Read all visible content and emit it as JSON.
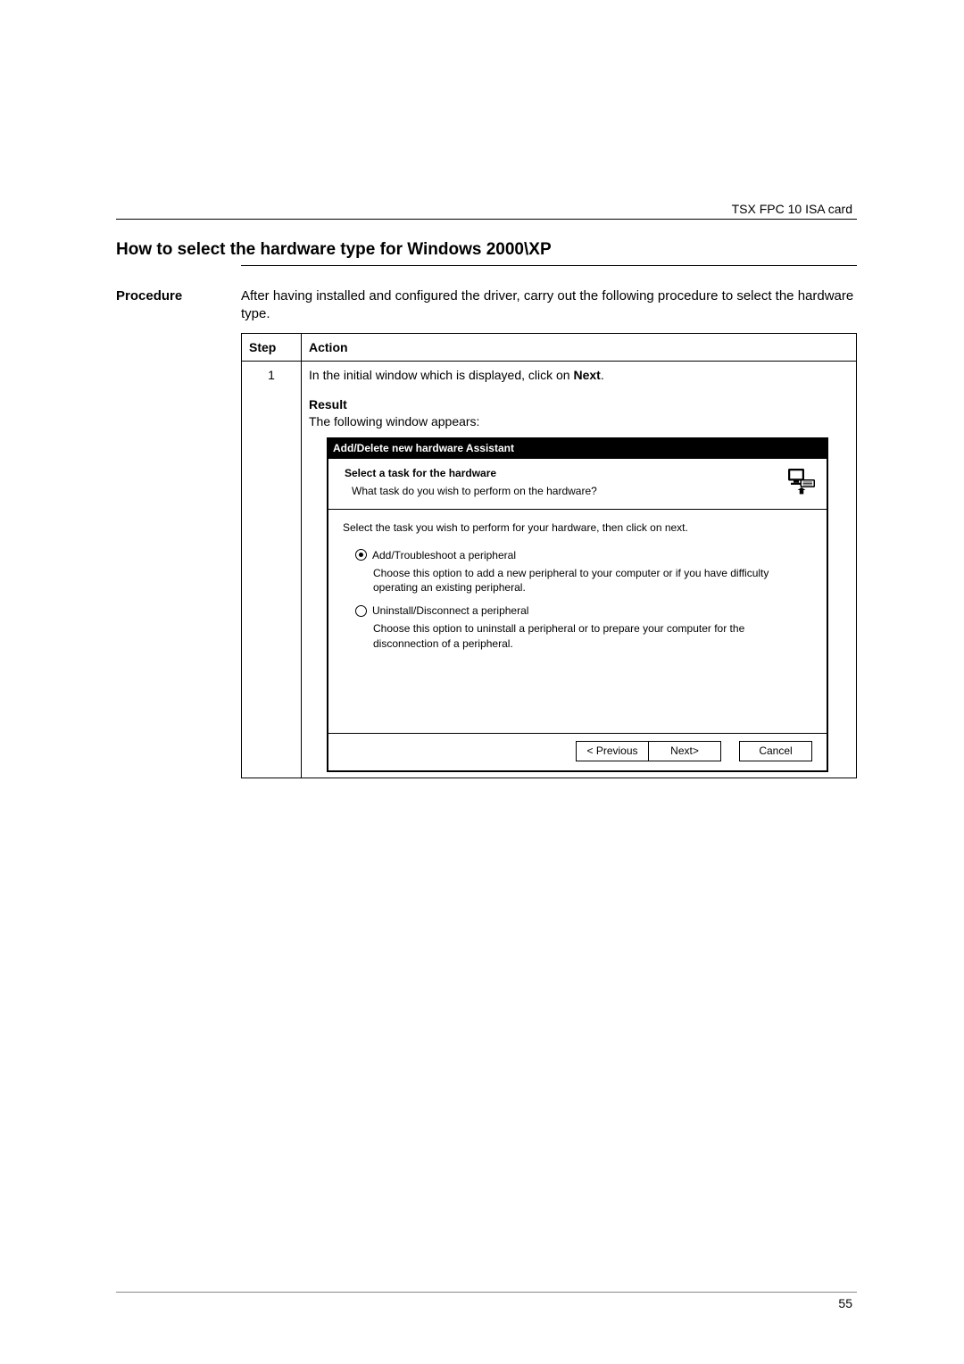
{
  "header": {
    "doc_label": "TSX FPC 10 ISA card"
  },
  "section_title": "How to select the hardware type for Windows 2000\\XP",
  "procedure": {
    "side_label": "Procedure",
    "intro": "After having installed and configured the driver, carry out the following procedure to select the hardware type.",
    "table": {
      "headers": {
        "step": "Step",
        "action": "Action"
      },
      "row1": {
        "step": "1",
        "action_pre": "In the initial window which is displayed, click on ",
        "action_bold": "Next",
        "action_post": ".",
        "result_label": "Result",
        "result_desc": "The following window appears:"
      }
    }
  },
  "wizard": {
    "titlebar": "Add/Delete new hardware Assistant",
    "header_title": "Select a task for the hardware",
    "header_sub": "What task do you wish to perform on the hardware?",
    "instruction": "Select the task you wish to perform for your hardware, then click on next.",
    "options": [
      {
        "label": "Add/Troubleshoot a peripheral",
        "desc": "Choose this option to add a new peripheral to your computer or if you have difficulty operating an existing peripheral.",
        "selected": true
      },
      {
        "label": "Uninstall/Disconnect a peripheral",
        "desc": "Choose this option to uninstall a peripheral or to prepare your computer for the disconnection of a peripheral.",
        "selected": false
      }
    ],
    "buttons": {
      "previous": "< Previous",
      "next": "Next>",
      "cancel": "Cancel"
    }
  },
  "footer": {
    "page_number": "55"
  }
}
